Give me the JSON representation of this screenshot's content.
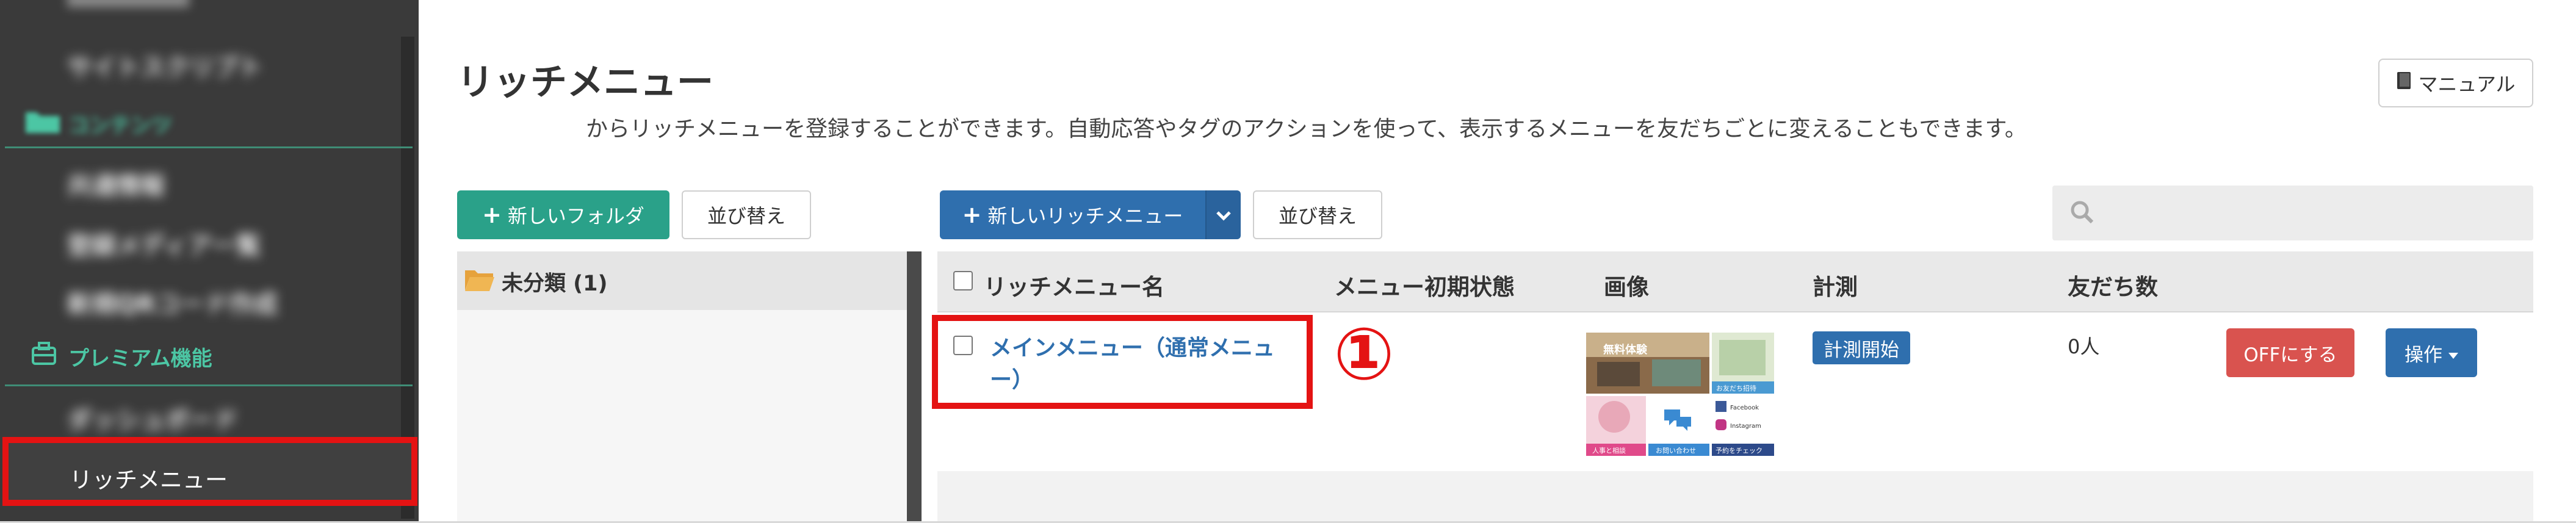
{
  "sidebar": {
    "items": [
      {
        "label": "サイトスクリプト"
      },
      {
        "label": "コンテンツ"
      },
      {
        "label": "共通情報"
      },
      {
        "label": "登録メディア一覧"
      },
      {
        "label": "新規QRコード作成"
      },
      {
        "label": "プレミアム機能"
      },
      {
        "label": "ダッシュボード"
      },
      {
        "label": "リッチメニュー"
      }
    ]
  },
  "header": {
    "title": "リッチメニュー",
    "description": "からリッチメニューを登録することができます。自動応答やタグのアクションを使って、表示するメニューを友だちごとに変えることもできます。",
    "manual_label": "マニュアル"
  },
  "toolbar": {
    "new_folder_label": "新しいフォルダ",
    "sort_label": "並び替え",
    "new_rich_menu_label": "新しいリッチメニュー",
    "sort_label_2": "並び替え"
  },
  "folders": {
    "items": [
      {
        "label": "未分類 (1)"
      }
    ]
  },
  "table": {
    "columns": [
      "リッチメニュー名",
      "メニュー初期状態",
      "画像",
      "計測",
      "友だち数"
    ],
    "rows": [
      {
        "name": "メインメニュー（通常メニュー）",
        "measure": "計測開始",
        "friends": "0人",
        "off_label": "OFFにする",
        "operation_label": "操作"
      }
    ]
  },
  "thumbnail": {
    "tile1_label": "無料体験",
    "tile2_label": "お友だち招待",
    "tile3_label": "人事と相談",
    "tile4_label": "お問い合わせ",
    "tile5_label": "Facebook",
    "tile6_label": "Instagram",
    "tile7_label": "予約をチェック"
  },
  "annotation": {
    "marker": "①"
  },
  "colors": {
    "accent_red": "#e41313",
    "primary_blue": "#2f6fae",
    "green": "#2aa189",
    "danger": "#d9534f"
  }
}
